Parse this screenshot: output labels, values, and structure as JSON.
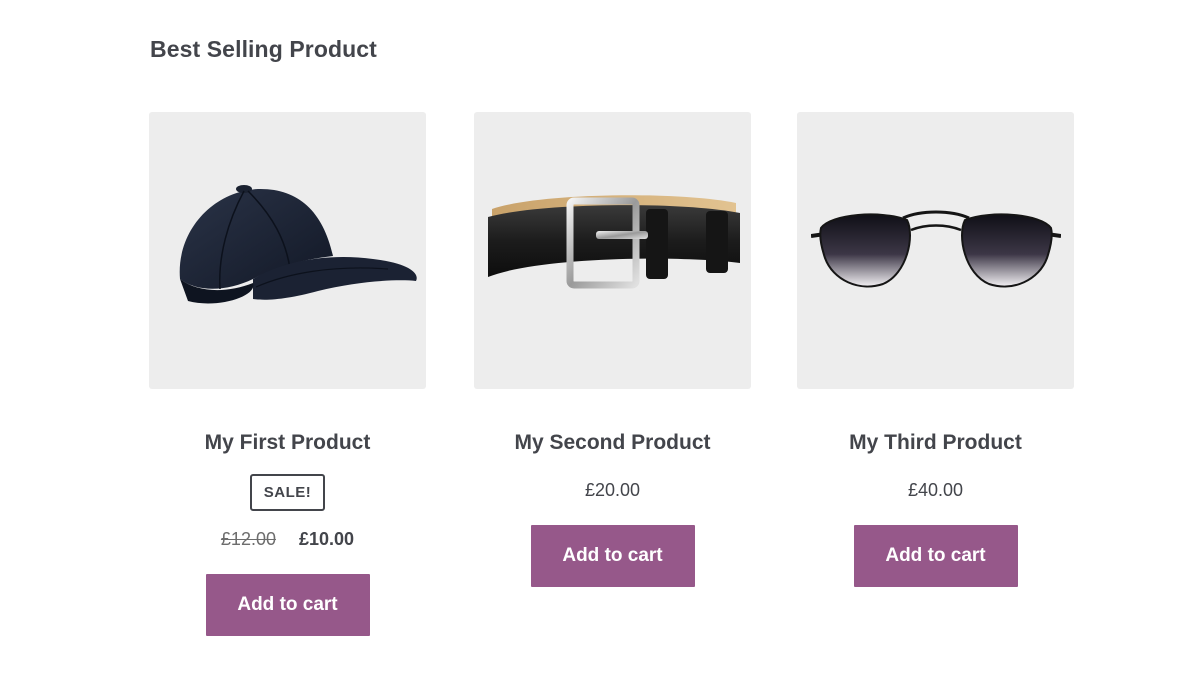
{
  "section": {
    "title": "Best Selling Product"
  },
  "products": [
    {
      "title": "My First Product",
      "sale_badge": "SALE!",
      "price_old": "£12.00",
      "price_new": "£10.00",
      "button_label": "Add to cart",
      "image_icon": "baseball-cap-icon"
    },
    {
      "title": "My Second Product",
      "price": "£20.00",
      "button_label": "Add to cart",
      "image_icon": "leather-belt-icon"
    },
    {
      "title": "My Third Product",
      "price": "£40.00",
      "button_label": "Add to cart",
      "image_icon": "aviator-sunglasses-icon"
    }
  ],
  "colors": {
    "button_bg": "#96588a",
    "image_bg": "#ededed",
    "text": "#43454b"
  }
}
